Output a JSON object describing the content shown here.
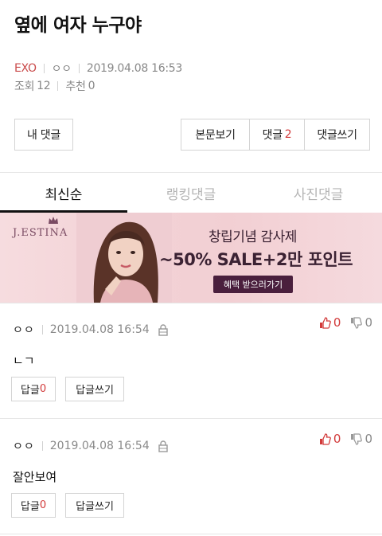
{
  "post": {
    "title": "옆에 여자 누구야",
    "category": "EXO",
    "author": "ㅇㅇ",
    "datetime": "2019.04.08 16:53",
    "views_label": "조회",
    "views": "12",
    "recommend_label": "추천",
    "recommend": "0"
  },
  "actions": {
    "my_comments": "내 댓글",
    "view_body": "본문보기",
    "comments_label": "댓글",
    "comments_count": "2",
    "write_comment": "댓글쓰기"
  },
  "tabs": [
    {
      "label": "최신순",
      "active": true
    },
    {
      "label": "랭킹댓글",
      "active": false
    },
    {
      "label": "사진댓글",
      "active": false
    }
  ],
  "banner": {
    "brand": "J.ESTINA",
    "line1": "창립기념 감사제",
    "line2": "~50% SALE+2만 포인트",
    "cta": "혜택 받으러가기",
    "bg_color": "#f3d2d6",
    "cta_color": "#4a1f3d"
  },
  "comments": [
    {
      "author": "ㅇㅇ",
      "datetime": "2019.04.08 16:54",
      "body": "ㄴㄱ",
      "up": "0",
      "down": "0",
      "reply_label": "답글",
      "reply_count": "0",
      "write_reply": "답글쓰기"
    },
    {
      "author": "ㅇㅇ",
      "datetime": "2019.04.08 16:54",
      "body": "잘안보여",
      "up": "0",
      "down": "0",
      "reply_label": "답글",
      "reply_count": "0",
      "write_reply": "답글쓰기"
    }
  ],
  "colors": {
    "accent_red": "#d23a3a",
    "meta_gray": "#888888",
    "border": "#d4d4d4"
  },
  "icons": {
    "lock": "lock-icon",
    "thumb_up": "thumbs-up-icon",
    "thumb_down": "thumbs-down-icon",
    "crown": "crown-icon"
  }
}
